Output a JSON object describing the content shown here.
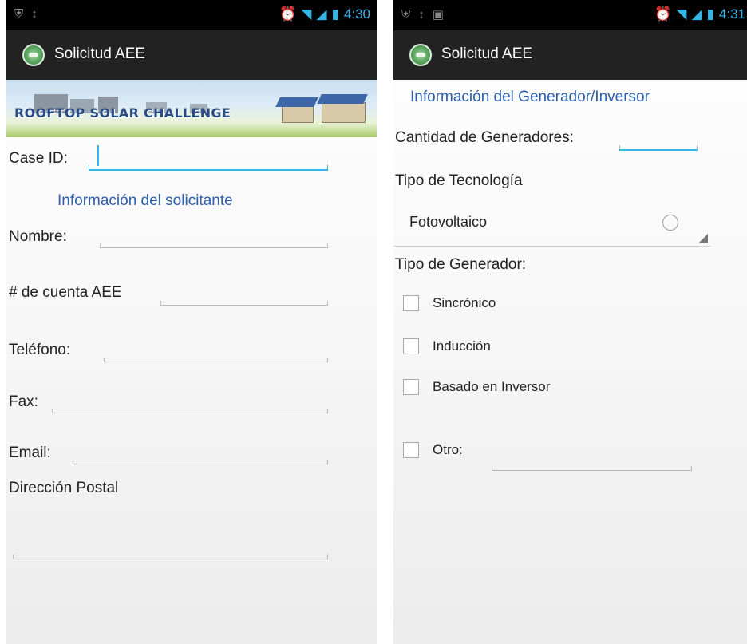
{
  "status_bar": {
    "left_time": "4:30",
    "right_time": "4:31"
  },
  "app": {
    "title": "Solicitud AEE"
  },
  "left": {
    "banner_text": "ROOFTOP SOLAR CHALLENGE",
    "case_id_label": "Case ID:",
    "section_title": "Información del solicitante",
    "fields": [
      {
        "label": "Nombre:"
      },
      {
        "label": "# de cuenta AEE"
      },
      {
        "label": "Teléfono:"
      },
      {
        "label": "Fax:"
      },
      {
        "label": "Email:"
      }
    ],
    "postal_label": "Dirección Postal"
  },
  "right": {
    "section_title": "Información del Generador/Inversor",
    "quantity_label": "Cantidad de Generadores:",
    "technology_label": "Tipo de Tecnología",
    "technology_value": "Fotovoltaico",
    "generator_label": "Tipo de Generador:",
    "options": [
      {
        "label": "Sincrónico",
        "checked": false
      },
      {
        "label": "Inducción",
        "checked": false
      },
      {
        "label": "Basado en Inversor",
        "checked": false
      },
      {
        "label": "Otro:",
        "checked": false
      }
    ]
  },
  "colors": {
    "accent": "#33b5e5",
    "section_text": "#2d5fae",
    "action_bar": "#222222"
  }
}
